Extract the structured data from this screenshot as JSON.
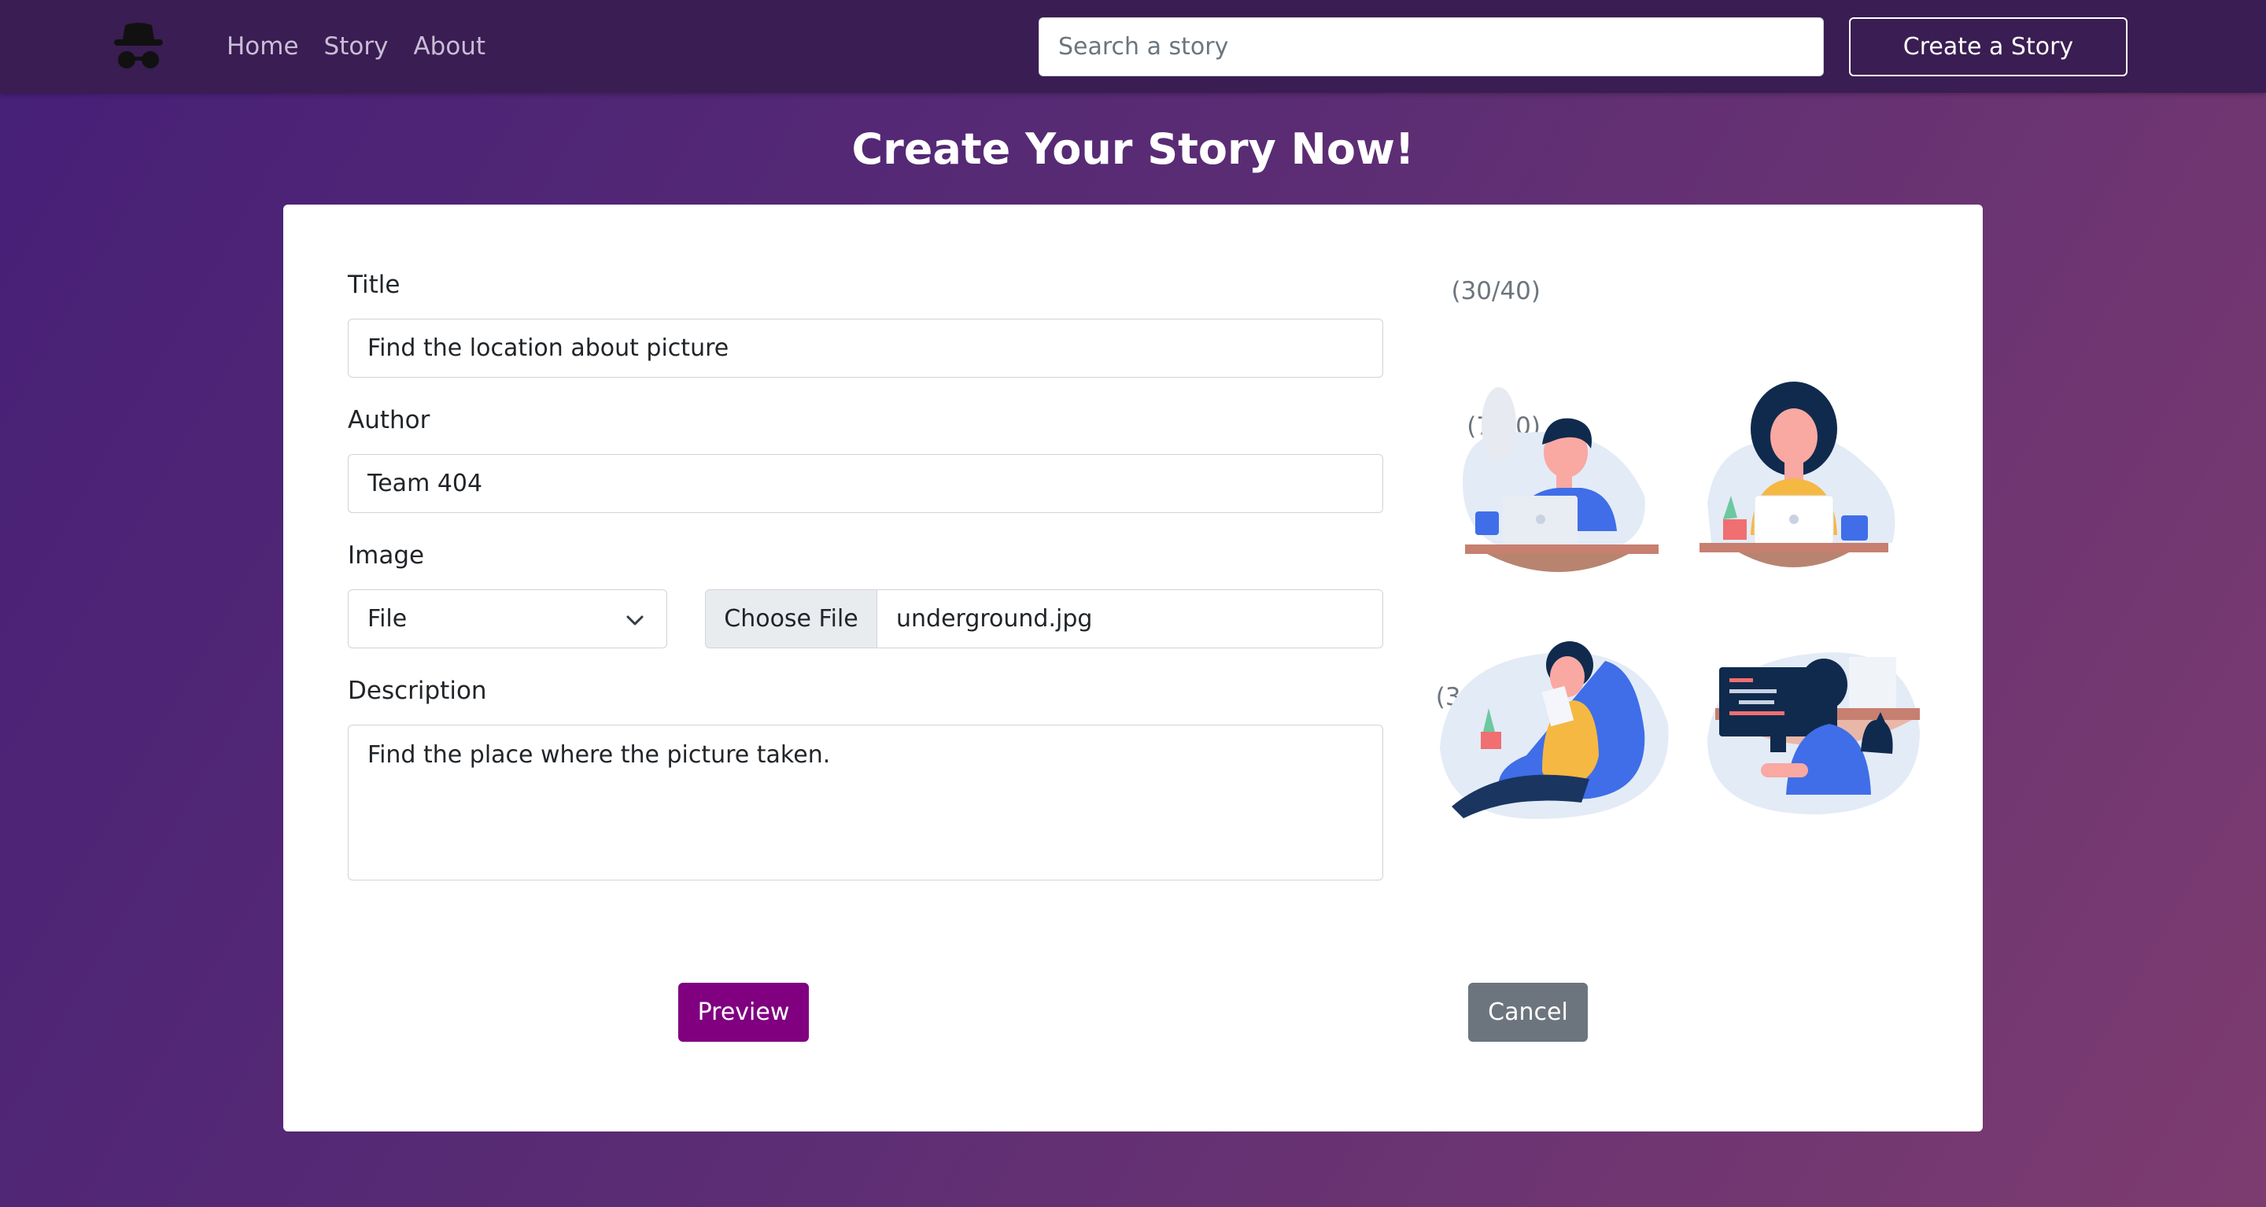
{
  "navbar": {
    "links": [
      "Home",
      "Story",
      "About"
    ],
    "search_placeholder": "Search a story",
    "create_label": "Create a Story"
  },
  "page": {
    "title": "Create Your Story Now!"
  },
  "form": {
    "title": {
      "label": "Title",
      "counter": "(30/40)",
      "value": "Find the location about picture"
    },
    "author": {
      "label": "Author",
      "counter": "(7/20)",
      "value": "Team 404"
    },
    "image": {
      "label": "Image",
      "source_selected": "File",
      "choose_file_label": "Choose File",
      "file_name": "underground.jpg"
    },
    "description": {
      "label": "Description",
      "counter": "(38/200)",
      "value": "Find the place where the picture taken."
    },
    "preview_label": "Preview",
    "cancel_label": "Cancel"
  },
  "colors": {
    "navbar_bg": "#3a1d52",
    "accent_preview": "#800080",
    "cancel_gray": "#6c757d",
    "illustration_blue": "#3f6ee8"
  },
  "icons": {
    "logo": "incognito-spy-icon",
    "select_arrow": "chevron-down-icon"
  }
}
